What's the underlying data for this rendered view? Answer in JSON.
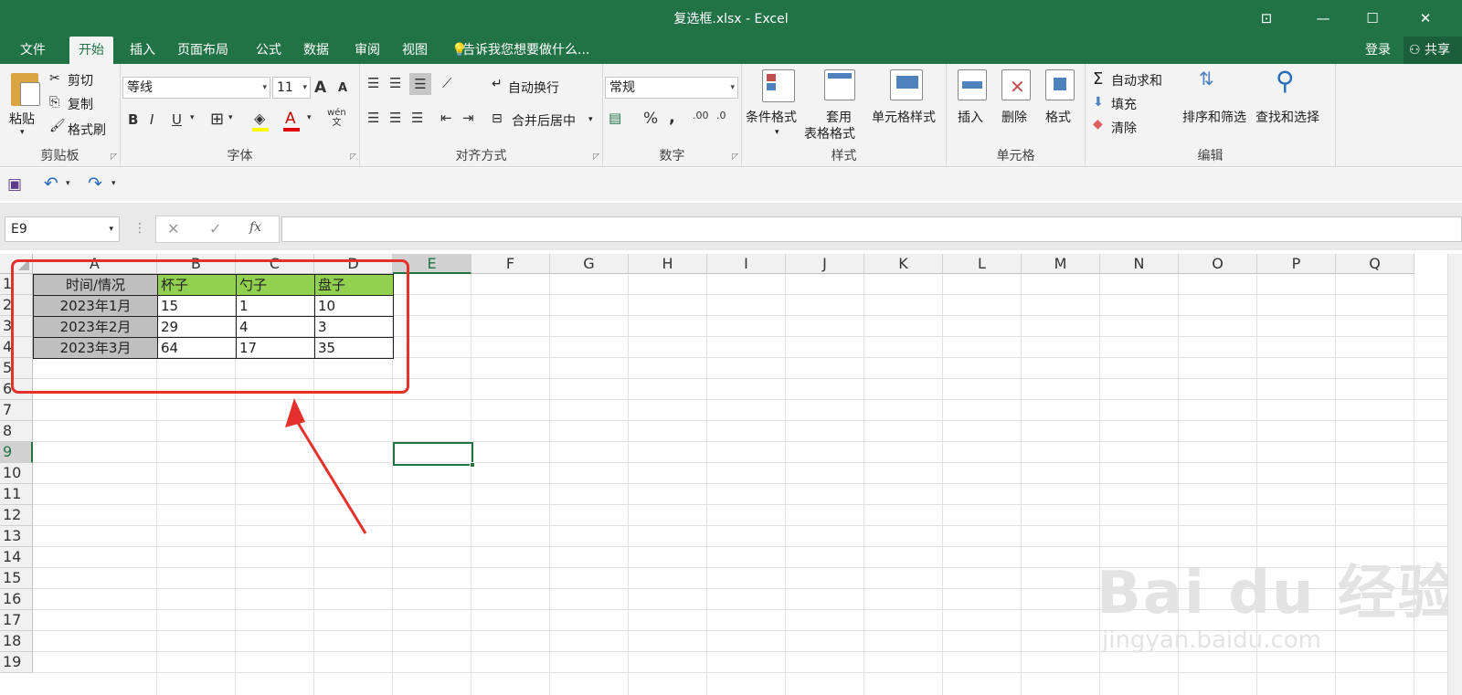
{
  "window": {
    "title": "复选框.xlsx - Excel",
    "ribbon_display_icon": "ribbon-display-icon",
    "minimize_icon": "minimize-icon",
    "maximize_icon": "maximize-icon",
    "close_icon": "close-icon"
  },
  "tabs": [
    "文件",
    "开始",
    "插入",
    "页面布局",
    "公式",
    "数据",
    "审阅",
    "视图"
  ],
  "active_tab": "开始",
  "tell_me": "告诉我您想要做什么...",
  "login": "登录",
  "share": "共享",
  "ribbon": {
    "clipboard": {
      "label": "剪贴板",
      "paste": "粘贴",
      "cut": "剪切",
      "copy": "复制",
      "format_painter": "格式刷"
    },
    "font": {
      "label": "字体",
      "font_name": "等线",
      "font_size": "11",
      "bold": "B",
      "italic": "I",
      "underline": "U",
      "grow": "A",
      "shrink": "A",
      "wen": "wén\n文",
      "font_color_letter": "A"
    },
    "alignment": {
      "label": "对齐方式",
      "wrap_text": "自动换行",
      "merge_center": "合并后居中"
    },
    "number": {
      "label": "数字",
      "format": "常规",
      "percent": "%",
      "comma": ","
    },
    "styles": {
      "label": "样式",
      "conditional": "条件格式",
      "table_a": "套用",
      "table_b": "表格格式",
      "cell_styles": "单元格样式"
    },
    "cells": {
      "label": "单元格",
      "insert": "插入",
      "delete": "删除",
      "format": "格式"
    },
    "editing": {
      "label": "编辑",
      "autosum": "自动求和",
      "fill": "填充",
      "clear": "清除",
      "sort_filter": "排序和筛选",
      "find_select": "查找和选择"
    }
  },
  "name_box": "E9",
  "formula_bar": {
    "fx": "fx",
    "value": ""
  },
  "columns": [
    "A",
    "B",
    "C",
    "D",
    "E",
    "F",
    "G",
    "H",
    "I",
    "J",
    "K",
    "L",
    "M",
    "N",
    "O",
    "P",
    "Q"
  ],
  "rows": [
    "1",
    "2",
    "3",
    "4",
    "5",
    "6",
    "7",
    "8",
    "9",
    "10",
    "11",
    "12",
    "13",
    "14",
    "15",
    "16",
    "17",
    "18",
    "19"
  ],
  "selected_cell": "E9",
  "table": {
    "header": [
      "时间/情况",
      "杯子",
      "勺子",
      "盘子"
    ],
    "body": [
      [
        "2023年1月",
        "15",
        "1",
        "10"
      ],
      [
        "2023年2月",
        "29",
        "4",
        "3"
      ],
      [
        "2023年3月",
        "64",
        "17",
        "35"
      ]
    ],
    "colors": {
      "label_fill": "#bfbfbf",
      "header_fill": "#92d050",
      "annotation": "#e4312b",
      "excel_green": "#217346"
    }
  },
  "watermark": {
    "line1": "Bai du 经验",
    "line2": "jingyan.baidu.com"
  }
}
